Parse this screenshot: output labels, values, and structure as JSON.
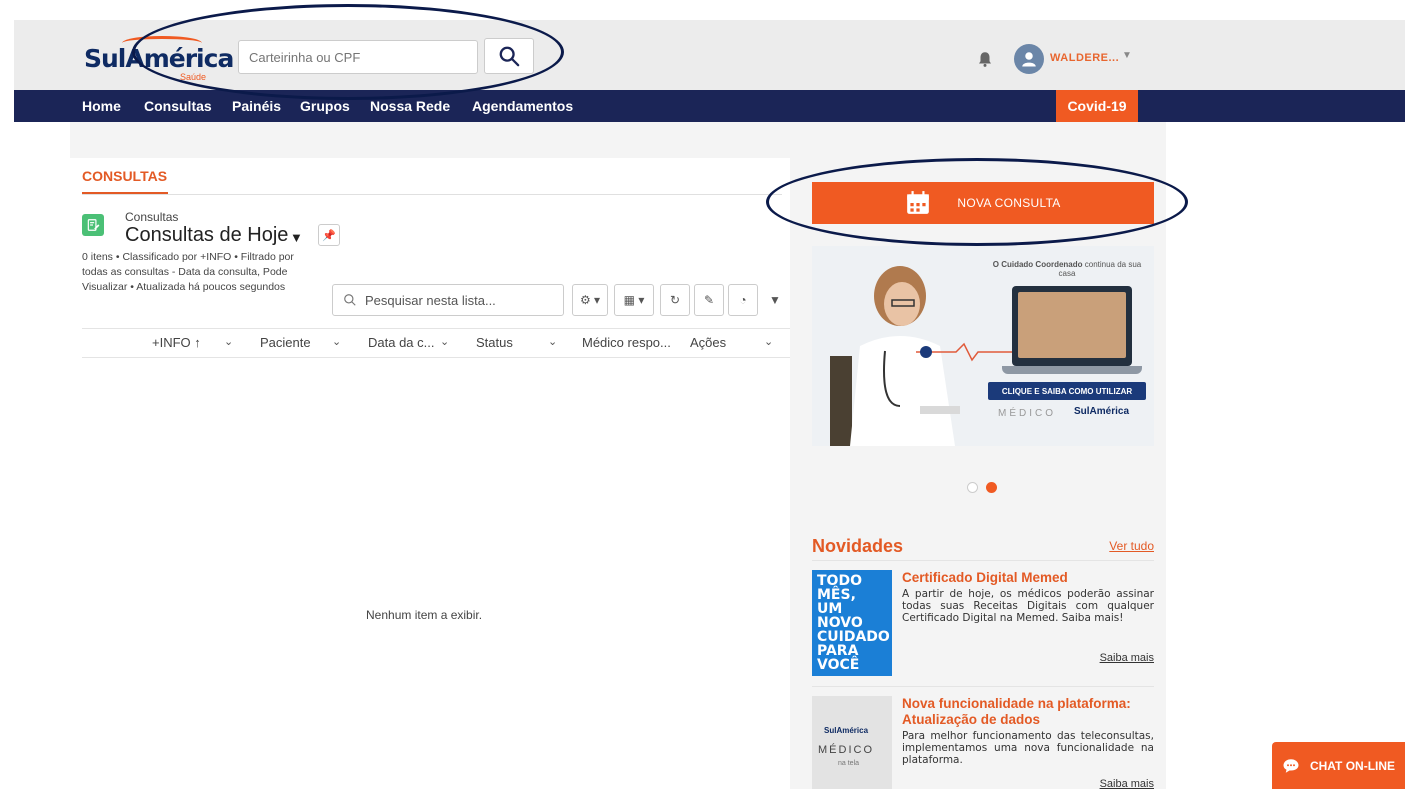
{
  "header": {
    "logo_text": "SulAmérica",
    "logo_sub": "Saúde",
    "search_placeholder": "Carteirinha ou CPF",
    "user_name": "WALDERE...",
    "icons": [
      "search-icon",
      "bell-icon",
      "user-avatar-icon",
      "caret-down-icon"
    ]
  },
  "nav": {
    "items": [
      "Home",
      "Consultas",
      "Painéis",
      "Grupos",
      "Nossa Rede",
      "Agendamentos"
    ],
    "covid": "Covid-19"
  },
  "consultas": {
    "tab": "CONSULTAS",
    "object_label": "Consultas",
    "list_title": "Consultas de Hoje",
    "meta": "0 itens • Classificado por +INFO • Filtrado por todas as consultas - Data da consulta, Pode Visualizar • Atualizada há poucos segundos",
    "search_placeholder": "Pesquisar nesta lista...",
    "columns": [
      "+INFO ↑",
      "Paciente",
      "Data da c...",
      "Status",
      "Médico respo...",
      "Ações"
    ],
    "empty": "Nenhum item a exibir."
  },
  "right": {
    "nova_consulta": "NOVA CONSULTA",
    "banner": {
      "caption_bold": "O Cuidado Coordenado",
      "caption_rest": " continua da sua casa",
      "cta": "CLIQUE E SAIBA COMO UTILIZAR",
      "brand1": "MÉDICO",
      "brand2": "SulAmérica"
    },
    "carousel_active": 2,
    "novidades_title": "Novidades",
    "ver_tudo": "Ver tudo",
    "news": [
      {
        "thumb_lines": [
          "TODO MÊS,",
          "UM NOVO",
          "CUIDADO",
          "PARA VOCÊ"
        ],
        "title": "Certificado Digital Memed",
        "body": "A partir de hoje, os médicos poderão assinar todas suas Receitas Digitais com qualquer Certificado Digital na Memed. Saiba mais!",
        "link": "Saiba mais"
      },
      {
        "thumb_lines": [
          "SulAmérica",
          "MÉDICO",
          "na tela"
        ],
        "title": "Nova funcionalidade na plataforma: Atualização de dados",
        "body": "Para melhor funcionamento das teleconsultas, implementamos uma nova funcionalidade na plataforma.",
        "link": "Saiba mais"
      }
    ]
  },
  "chat": {
    "label": "CHAT ON-LINE"
  },
  "colors": {
    "navy": "#1b2557",
    "orange": "#f05a22",
    "green": "#4bc076"
  }
}
